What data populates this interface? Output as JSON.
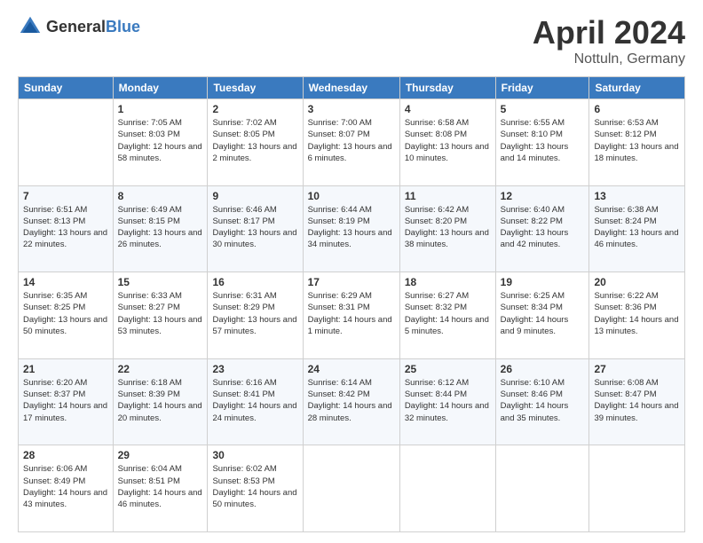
{
  "header": {
    "logo": {
      "text_general": "General",
      "text_blue": "Blue"
    },
    "title": "April 2024",
    "location": "Nottuln, Germany"
  },
  "calendar": {
    "weekdays": [
      "Sunday",
      "Monday",
      "Tuesday",
      "Wednesday",
      "Thursday",
      "Friday",
      "Saturday"
    ],
    "weeks": [
      [
        {
          "day": "",
          "sunrise": "",
          "sunset": "",
          "daylight": ""
        },
        {
          "day": "1",
          "sunrise": "Sunrise: 7:05 AM",
          "sunset": "Sunset: 8:03 PM",
          "daylight": "Daylight: 12 hours and 58 minutes."
        },
        {
          "day": "2",
          "sunrise": "Sunrise: 7:02 AM",
          "sunset": "Sunset: 8:05 PM",
          "daylight": "Daylight: 13 hours and 2 minutes."
        },
        {
          "day": "3",
          "sunrise": "Sunrise: 7:00 AM",
          "sunset": "Sunset: 8:07 PM",
          "daylight": "Daylight: 13 hours and 6 minutes."
        },
        {
          "day": "4",
          "sunrise": "Sunrise: 6:58 AM",
          "sunset": "Sunset: 8:08 PM",
          "daylight": "Daylight: 13 hours and 10 minutes."
        },
        {
          "day": "5",
          "sunrise": "Sunrise: 6:55 AM",
          "sunset": "Sunset: 8:10 PM",
          "daylight": "Daylight: 13 hours and 14 minutes."
        },
        {
          "day": "6",
          "sunrise": "Sunrise: 6:53 AM",
          "sunset": "Sunset: 8:12 PM",
          "daylight": "Daylight: 13 hours and 18 minutes."
        }
      ],
      [
        {
          "day": "7",
          "sunrise": "Sunrise: 6:51 AM",
          "sunset": "Sunset: 8:13 PM",
          "daylight": "Daylight: 13 hours and 22 minutes."
        },
        {
          "day": "8",
          "sunrise": "Sunrise: 6:49 AM",
          "sunset": "Sunset: 8:15 PM",
          "daylight": "Daylight: 13 hours and 26 minutes."
        },
        {
          "day": "9",
          "sunrise": "Sunrise: 6:46 AM",
          "sunset": "Sunset: 8:17 PM",
          "daylight": "Daylight: 13 hours and 30 minutes."
        },
        {
          "day": "10",
          "sunrise": "Sunrise: 6:44 AM",
          "sunset": "Sunset: 8:19 PM",
          "daylight": "Daylight: 13 hours and 34 minutes."
        },
        {
          "day": "11",
          "sunrise": "Sunrise: 6:42 AM",
          "sunset": "Sunset: 8:20 PM",
          "daylight": "Daylight: 13 hours and 38 minutes."
        },
        {
          "day": "12",
          "sunrise": "Sunrise: 6:40 AM",
          "sunset": "Sunset: 8:22 PM",
          "daylight": "Daylight: 13 hours and 42 minutes."
        },
        {
          "day": "13",
          "sunrise": "Sunrise: 6:38 AM",
          "sunset": "Sunset: 8:24 PM",
          "daylight": "Daylight: 13 hours and 46 minutes."
        }
      ],
      [
        {
          "day": "14",
          "sunrise": "Sunrise: 6:35 AM",
          "sunset": "Sunset: 8:25 PM",
          "daylight": "Daylight: 13 hours and 50 minutes."
        },
        {
          "day": "15",
          "sunrise": "Sunrise: 6:33 AM",
          "sunset": "Sunset: 8:27 PM",
          "daylight": "Daylight: 13 hours and 53 minutes."
        },
        {
          "day": "16",
          "sunrise": "Sunrise: 6:31 AM",
          "sunset": "Sunset: 8:29 PM",
          "daylight": "Daylight: 13 hours and 57 minutes."
        },
        {
          "day": "17",
          "sunrise": "Sunrise: 6:29 AM",
          "sunset": "Sunset: 8:31 PM",
          "daylight": "Daylight: 14 hours and 1 minute."
        },
        {
          "day": "18",
          "sunrise": "Sunrise: 6:27 AM",
          "sunset": "Sunset: 8:32 PM",
          "daylight": "Daylight: 14 hours and 5 minutes."
        },
        {
          "day": "19",
          "sunrise": "Sunrise: 6:25 AM",
          "sunset": "Sunset: 8:34 PM",
          "daylight": "Daylight: 14 hours and 9 minutes."
        },
        {
          "day": "20",
          "sunrise": "Sunrise: 6:22 AM",
          "sunset": "Sunset: 8:36 PM",
          "daylight": "Daylight: 14 hours and 13 minutes."
        }
      ],
      [
        {
          "day": "21",
          "sunrise": "Sunrise: 6:20 AM",
          "sunset": "Sunset: 8:37 PM",
          "daylight": "Daylight: 14 hours and 17 minutes."
        },
        {
          "day": "22",
          "sunrise": "Sunrise: 6:18 AM",
          "sunset": "Sunset: 8:39 PM",
          "daylight": "Daylight: 14 hours and 20 minutes."
        },
        {
          "day": "23",
          "sunrise": "Sunrise: 6:16 AM",
          "sunset": "Sunset: 8:41 PM",
          "daylight": "Daylight: 14 hours and 24 minutes."
        },
        {
          "day": "24",
          "sunrise": "Sunrise: 6:14 AM",
          "sunset": "Sunset: 8:42 PM",
          "daylight": "Daylight: 14 hours and 28 minutes."
        },
        {
          "day": "25",
          "sunrise": "Sunrise: 6:12 AM",
          "sunset": "Sunset: 8:44 PM",
          "daylight": "Daylight: 14 hours and 32 minutes."
        },
        {
          "day": "26",
          "sunrise": "Sunrise: 6:10 AM",
          "sunset": "Sunset: 8:46 PM",
          "daylight": "Daylight: 14 hours and 35 minutes."
        },
        {
          "day": "27",
          "sunrise": "Sunrise: 6:08 AM",
          "sunset": "Sunset: 8:47 PM",
          "daylight": "Daylight: 14 hours and 39 minutes."
        }
      ],
      [
        {
          "day": "28",
          "sunrise": "Sunrise: 6:06 AM",
          "sunset": "Sunset: 8:49 PM",
          "daylight": "Daylight: 14 hours and 43 minutes."
        },
        {
          "day": "29",
          "sunrise": "Sunrise: 6:04 AM",
          "sunset": "Sunset: 8:51 PM",
          "daylight": "Daylight: 14 hours and 46 minutes."
        },
        {
          "day": "30",
          "sunrise": "Sunrise: 6:02 AM",
          "sunset": "Sunset: 8:53 PM",
          "daylight": "Daylight: 14 hours and 50 minutes."
        },
        {
          "day": "",
          "sunrise": "",
          "sunset": "",
          "daylight": ""
        },
        {
          "day": "",
          "sunrise": "",
          "sunset": "",
          "daylight": ""
        },
        {
          "day": "",
          "sunrise": "",
          "sunset": "",
          "daylight": ""
        },
        {
          "day": "",
          "sunrise": "",
          "sunset": "",
          "daylight": ""
        }
      ]
    ]
  }
}
